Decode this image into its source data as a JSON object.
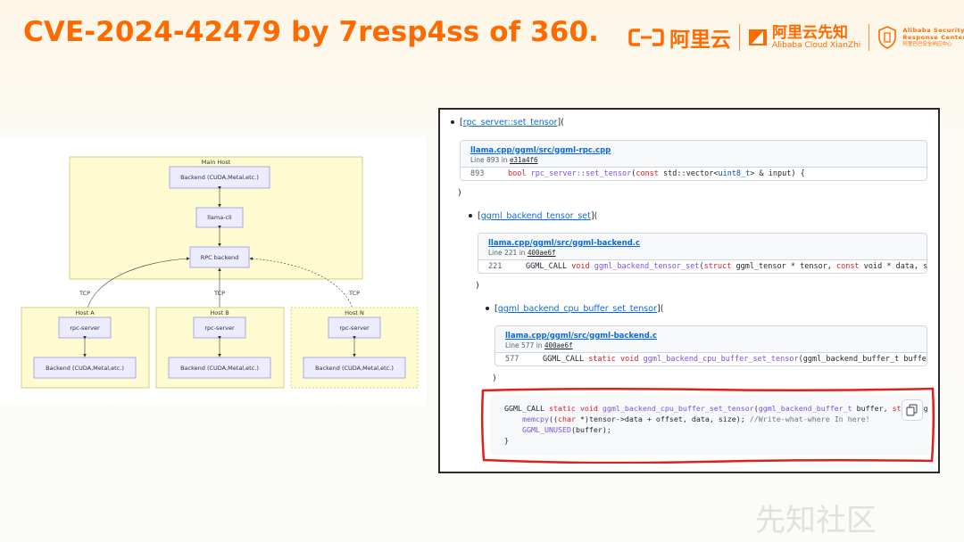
{
  "slide": {
    "title": "CVE-2024-42479 by 7resp4ss of 360.",
    "accent_color": "#ff6a00"
  },
  "logos": {
    "aliyun_text": "阿里云",
    "xianzhi_cn": "阿里云先知",
    "xianzhi_en": "Alibaba Cloud XianZhi",
    "asrc_line1": "Alibaba Security",
    "asrc_line2": "Response Center",
    "asrc_line3": "阿里巴巴安全响应中心"
  },
  "diagram": {
    "main_host_label": "Main Host",
    "main_backend": "Backend (CUDA,Metal,etc.)",
    "llama_cli": "llama-cli",
    "rpc_backend": "RPC backend",
    "tcp_labels": [
      "TCP",
      "TCP",
      "TCP"
    ],
    "hosts": [
      {
        "name": "Host A",
        "server": "rpc-server",
        "backend": "Backend (CUDA,Metal,etc.)"
      },
      {
        "name": "Host B",
        "server": "rpc-server",
        "backend": "Backend (CUDA,Metal,etc.)"
      },
      {
        "name": "Host N",
        "server": "rpc-server",
        "backend": "Backend (CUDA,Metal,etc.)"
      }
    ]
  },
  "code_panel": {
    "items": [
      {
        "bullet_link": "rpc_server::set_tensor",
        "suffix": "(",
        "card": {
          "path": "llama.cpp/ggml/src/ggml-rpc.cpp",
          "line_prefix": "Line 893 in",
          "commit": "e31a4f6",
          "line_number": "893",
          "code_kw1": "bool",
          "code_fn": "rpc_server::set_tensor",
          "code_rest_a": "(",
          "code_kw2": "const",
          "code_rest_b": " std::vector<",
          "code_ty": "uint8_t",
          "code_rest_c": "> & input) {"
        },
        "close": ")"
      },
      {
        "bullet_link": "ggml_backend_tensor_set",
        "suffix": "(",
        "card": {
          "path": "llama.cpp/ggml/src/ggml-backend.c",
          "line_prefix": "Line 221 in",
          "commit": "400ae6f",
          "line_number": "221",
          "code_pre": "GGML_CALL ",
          "code_kw1": "void",
          "code_fn": "ggml_backend_tensor_set",
          "code_rest_a": "(",
          "code_kw2": "struct",
          "code_rest_b": " ggml_tensor * tensor, ",
          "code_kw3": "const",
          "code_rest_c": " void * data, size"
        },
        "close": ")"
      },
      {
        "bullet_link": "ggml_backend_cpu_buffer_set_tensor",
        "suffix": "(",
        "card": {
          "path": "llama.cpp/ggml/src/ggml-backend.c",
          "line_prefix": "Line 577 in",
          "commit": "400ae6f",
          "line_number": "577",
          "code_pre": "GGML_CALL ",
          "code_kw1": "static",
          "code_rest_x": " ",
          "code_kw2": "void",
          "code_fn": "ggml_backend_cpu_buffer_set_tensor",
          "code_rest_a": "(ggml_backend_buffer_t buffer,"
        },
        "close": ")"
      }
    ],
    "snippet": {
      "l1_pre": "GGML_CALL ",
      "l1_kw1": "static",
      "l1_kw2": "void",
      "l1_fn": "ggml_backend_cpu_buffer_set_tensor",
      "l1_a": "(",
      "l1_ty": "ggml_backend_buffer_t",
      "l1_b": " buffer, ",
      "l1_kw3": "stru",
      "l1_c": "ct g",
      "l2_fn": "memcpy",
      "l2_a": "((",
      "l2_kw": "char",
      "l2_b": " *)tensor->data + offset, data, size);  ",
      "l2_cm": "//Write-what-where In here!",
      "l3_fn": "GGML_UNUSED",
      "l3_a": "(buffer);",
      "l4": "}"
    },
    "highlight_color": "#e0201b"
  },
  "watermark": "先知社区"
}
